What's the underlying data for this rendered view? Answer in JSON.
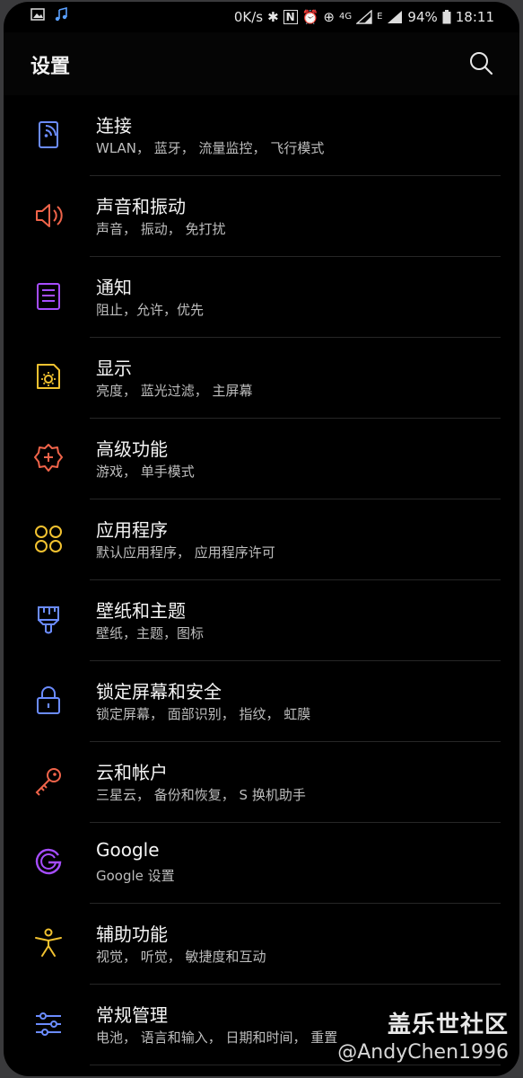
{
  "status": {
    "speed": "0K/s",
    "network": "4G",
    "network_e": "E",
    "battery": "94%",
    "time": "18:11"
  },
  "header": {
    "title": "设置"
  },
  "items": [
    {
      "label": "连接",
      "sub": "WLAN， 蓝牙， 流量监控， 飞行模式",
      "icon": "connections-icon",
      "color": "#6b8cff"
    },
    {
      "label": "声音和振动",
      "sub": "声音， 振动， 免打扰",
      "icon": "speaker-icon",
      "color": "#f0644a"
    },
    {
      "label": "通知",
      "sub": "阻止，允许，优先",
      "icon": "notification-icon",
      "color": "#a64dff"
    },
    {
      "label": "显示",
      "sub": "亮度， 蓝光过滤， 主屏幕",
      "icon": "display-icon",
      "color": "#f2c230"
    },
    {
      "label": "高级功能",
      "sub": "游戏， 单手模式",
      "icon": "advanced-features-icon",
      "color": "#f0644a"
    },
    {
      "label": "应用程序",
      "sub": "默认应用程序， 应用程序许可",
      "icon": "apps-icon",
      "color": "#f2c230"
    },
    {
      "label": "壁纸和主题",
      "sub": "壁纸，主题，图标",
      "icon": "brush-icon",
      "color": "#6b8cff"
    },
    {
      "label": "锁定屏幕和安全",
      "sub": "锁定屏幕， 面部识别， 指纹， 虹膜",
      "icon": "lock-icon",
      "color": "#6b8cff"
    },
    {
      "label": "云和帐户",
      "sub": "三星云， 备份和恢复， S 换机助手",
      "icon": "key-icon",
      "color": "#f0644a"
    },
    {
      "label": "Google",
      "sub": "Google 设置",
      "icon": "google-icon",
      "color": "#a64dff"
    },
    {
      "label": "辅助功能",
      "sub": "视觉， 听觉， 敏捷度和互动",
      "icon": "accessibility-icon",
      "color": "#f2c230"
    },
    {
      "label": "常规管理",
      "sub": "电池， 语言和输入， 日期和时间， 重置",
      "icon": "sliders-icon",
      "color": "#6b8cff"
    }
  ],
  "watermark": {
    "line1": "盖乐世社区",
    "line2": "@AndyChen1996"
  }
}
